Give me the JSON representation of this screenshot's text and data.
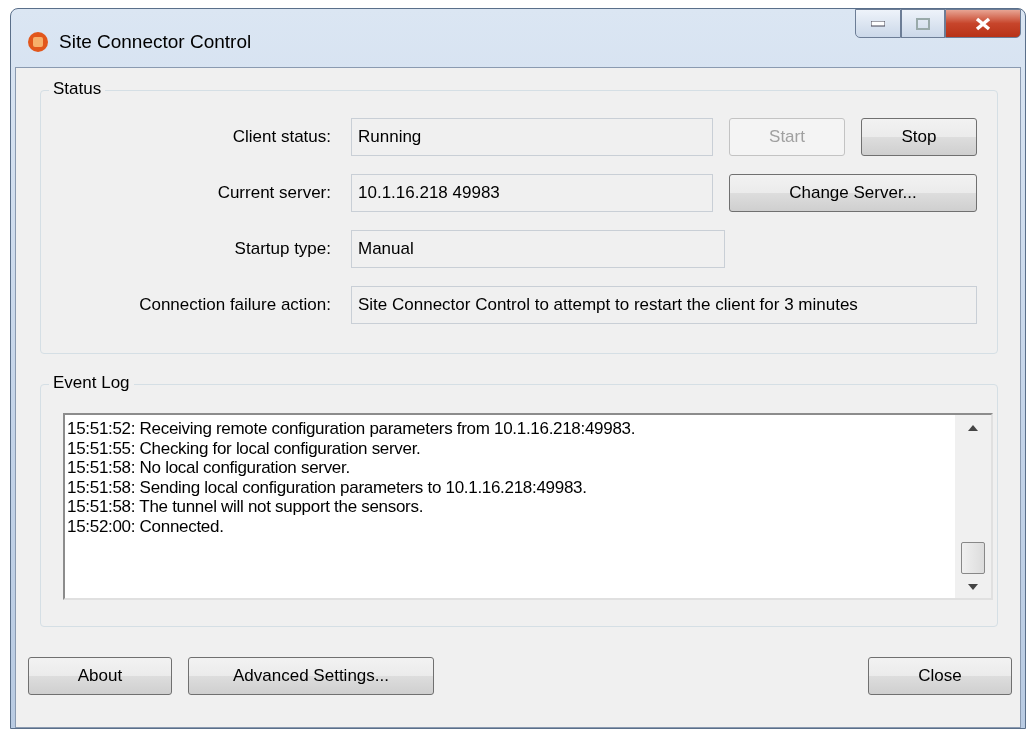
{
  "window": {
    "title": "Site Connector Control"
  },
  "status": {
    "title": "Status",
    "fields": [
      {
        "label": "Client status:",
        "value": "Running",
        "buttons": [
          {
            "label": "Start",
            "disabled": true
          },
          {
            "label": "Stop",
            "disabled": false
          }
        ]
      },
      {
        "label": "Current server:",
        "value": "10.1.16.218 49983",
        "buttons": [
          {
            "label": "Change Server...",
            "disabled": false
          }
        ]
      },
      {
        "label": "Startup type:",
        "value": "Manual"
      },
      {
        "label": "Connection failure action:",
        "value": "Site Connector Control to attempt to restart the client for 3 minutes",
        "kind": "wide"
      }
    ]
  },
  "event_log": {
    "title": "Event Log",
    "lines": [
      "15:51:52: Receiving remote configuration parameters from 10.1.16.218:49983.",
      "15:51:55: Checking for local configuration server.",
      "15:51:58: No local configuration server.",
      "15:51:58: Sending local configuration parameters to 10.1.16.218:49983.",
      "15:51:58: The tunnel will not support the sensors.",
      "15:52:00: Connected."
    ]
  },
  "buttons_left": [
    "About",
    "Advanced Settings..."
  ],
  "buttons_right": [
    "Close"
  ]
}
